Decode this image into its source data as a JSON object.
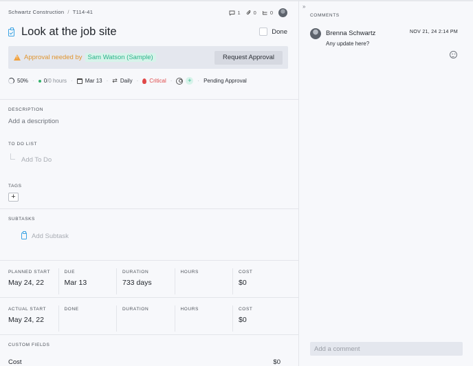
{
  "breadcrumb": {
    "project": "Schwartz Construction",
    "separator": "/",
    "task_id": "T114-41"
  },
  "meta": {
    "comments_count": "1",
    "attachments_count": "0",
    "subtasks_count": "0"
  },
  "task": {
    "title": "Look at the job site",
    "done_label": "Done"
  },
  "approval": {
    "prefix": "Approval needed by",
    "approver": "Sam Watson (Sample)",
    "button_label": "Request Approval",
    "warning_icon": "warning-triangle-icon",
    "accent_color": "#f0a240"
  },
  "properties": {
    "progress": "50%",
    "hours_done": "0",
    "hours_total": "/0 hours",
    "due_date": "Mar 13",
    "recurrence": "Daily",
    "priority": "Critical",
    "priority_color": "#e04848",
    "status": "Pending Approval"
  },
  "sections": {
    "description_label": "DESCRIPTION",
    "description_placeholder": "Add a description",
    "todo_label": "TO DO LIST",
    "todo_placeholder": "Add To Do",
    "tags_label": "TAGS",
    "tags_add": "+",
    "subtasks_label": "SUBTASKS",
    "subtasks_placeholder": "Add Subtask"
  },
  "planned": [
    {
      "label": "PLANNED START",
      "value": "May 24, 22"
    },
    {
      "label": "DUE",
      "value": "Mar 13"
    },
    {
      "label": "DURATION",
      "value": "733 days"
    },
    {
      "label": "HOURS",
      "value": ""
    },
    {
      "label": "COST",
      "value": "$0"
    }
  ],
  "actual": [
    {
      "label": "ACTUAL START",
      "value": "May 24, 22"
    },
    {
      "label": "DONE",
      "value": ""
    },
    {
      "label": "DURATION",
      "value": ""
    },
    {
      "label": "HOURS",
      "value": ""
    },
    {
      "label": "COST",
      "value": "$0"
    }
  ],
  "custom_fields": {
    "label": "CUSTOM FIELDS",
    "rows": [
      {
        "name": "Cost",
        "value": "$0"
      }
    ]
  },
  "comments_panel": {
    "collapse_glyph": "»",
    "label": "COMMENTS",
    "items": [
      {
        "author": "Brenna Schwartz",
        "date": "NOV 21, 24 2:14 PM",
        "text": "Any update here?"
      }
    ],
    "input_placeholder": "Add a comment"
  }
}
